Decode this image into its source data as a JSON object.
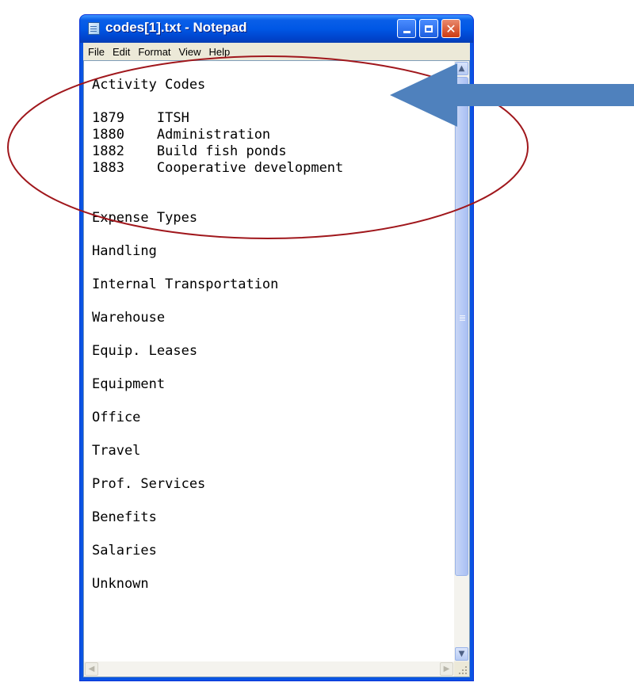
{
  "window": {
    "title": "codes[1].txt - Notepad",
    "title_bar_color": "#0a54e2",
    "close_button_color": "#cc3a12"
  },
  "menubar": {
    "items": [
      {
        "label": "File"
      },
      {
        "label": "Edit"
      },
      {
        "label": "Format"
      },
      {
        "label": "View"
      },
      {
        "label": "Help"
      }
    ]
  },
  "editor": {
    "lines": [
      "Activity Codes",
      "",
      "1879    ITSH",
      "1880    Administration",
      "1882    Build fish ponds",
      "1883    Cooperative development",
      "",
      "",
      "Expense Types",
      "",
      "Handling",
      "",
      "Internal Transportation",
      "",
      "Warehouse",
      "",
      "Equip. Leases",
      "",
      "Equipment",
      "",
      "Office",
      "",
      "Travel",
      "",
      "Prof. Services",
      "",
      "Benefits",
      "",
      "Salaries",
      "",
      "Unknown"
    ]
  },
  "annotations": {
    "highlight_ellipse_color": "#a0171c",
    "arrow_color": "#4f81bd"
  },
  "icons": {
    "app": "notepad-icon",
    "minimize": "minimize-icon",
    "maximize": "maximize-icon",
    "close": "close-icon"
  }
}
